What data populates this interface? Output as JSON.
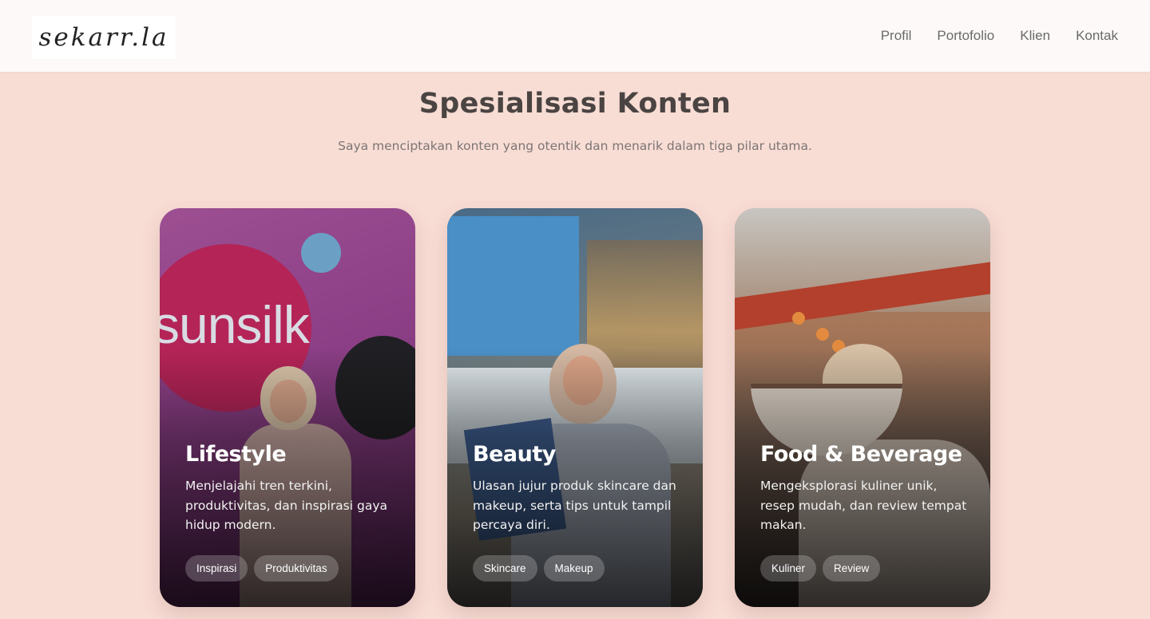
{
  "header": {
    "logo": "sekarr.la",
    "nav": [
      "Profil",
      "Portofolio",
      "Klien",
      "Kontak"
    ]
  },
  "section": {
    "title": "Spesialisasi Konten",
    "subtitle": "Saya menciptakan konten yang otentik dan menarik dalam tiga pilar utama."
  },
  "cards": [
    {
      "title": "Lifestyle",
      "description": "Menjelajahi tren terkini, produktivitas, dan inspirasi gaya hidup modern.",
      "tags": [
        "Inspirasi",
        "Produktivitas"
      ],
      "image_text": "sunsilk"
    },
    {
      "title": "Beauty",
      "description": "Ulasan jujur produk skincare dan makeup, serta tips untuk tampil percaya diri.",
      "tags": [
        "Skincare",
        "Makeup"
      ]
    },
    {
      "title": "Food & Beverage",
      "description": "Mengeksplorasi kuliner unik, resep mudah, dan review tempat makan.",
      "tags": [
        "Kuliner",
        "Review"
      ]
    }
  ],
  "colors": {
    "page_background": "#f8ddd5",
    "header_background": "#fdf9f8",
    "title_text": "#4a4442",
    "tag_background": "rgba(255,255,255,0.22)"
  }
}
